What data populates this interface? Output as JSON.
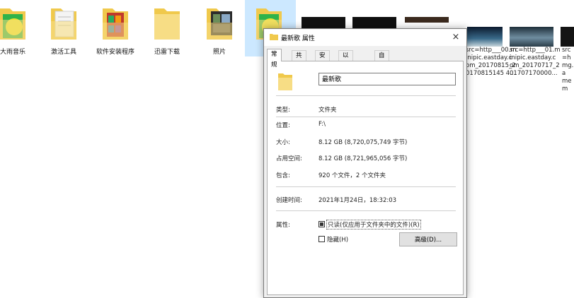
{
  "files": [
    {
      "label": "大雨音乐",
      "art": "green"
    },
    {
      "label": "激活工具",
      "art": "document"
    },
    {
      "label": "软件安装程序",
      "art": "colorful"
    },
    {
      "label": "迅雷下载",
      "art": "plain"
    },
    {
      "label": "照片",
      "art": "photos"
    },
    {
      "label": "",
      "art": "green",
      "selected": true
    }
  ],
  "thumbnails": [
    {
      "lines": [],
      "art": "dark"
    },
    {
      "lines": [],
      "art": "dark"
    },
    {
      "lines": [],
      "art": "brown"
    },
    {
      "lines": [
        "src=http___00.m",
        "inipic.eastday.c",
        "om_20170815_2",
        "0170815145 4..."
      ],
      "art": "night"
    },
    {
      "lines": [
        "src=http___01.m",
        "inipic.eastday.c",
        "om_20170717_2",
        "01707170000..."
      ],
      "art": "sea"
    },
    {
      "lines": [
        "src=h",
        "mg.a",
        "mem"
      ],
      "art": "dark"
    }
  ],
  "dialog": {
    "title": "最新歌 属性",
    "close_icon": "×",
    "tabs": [
      "常规",
      "共享",
      "安全",
      "以前的版本",
      "自定义"
    ],
    "active_tab": "常规",
    "name": "最新歌",
    "properties": {
      "type_label": "类型:",
      "type_value": "文件夹",
      "location_label": "位置:",
      "location_value": "F:\\",
      "size_label": "大小:",
      "size_value": "8.12 GB (8,720,075,749 字节)",
      "disk_size_label": "占用空间:",
      "disk_size_value": "8.12 GB (8,721,965,056 字节)",
      "contains_label": "包含:",
      "contains_value": "920 个文件，2 个文件夹",
      "created_label": "创建时间:",
      "created_value": "2021年1月24日，18:32:03",
      "attributes_label": "属性:"
    },
    "readonly_label": "只读(仅应用于文件夹中的文件)(R)",
    "readonly_checked": "indeterminate",
    "hidden_label": "隐藏(H)",
    "hidden_checked": false,
    "advanced_button": "高级(D)..."
  },
  "colors": {
    "folder": "#f0c94c",
    "folder_light": "#f7dd85",
    "selection": "#cce8ff",
    "dialog_bg": "#f0f0f0"
  }
}
